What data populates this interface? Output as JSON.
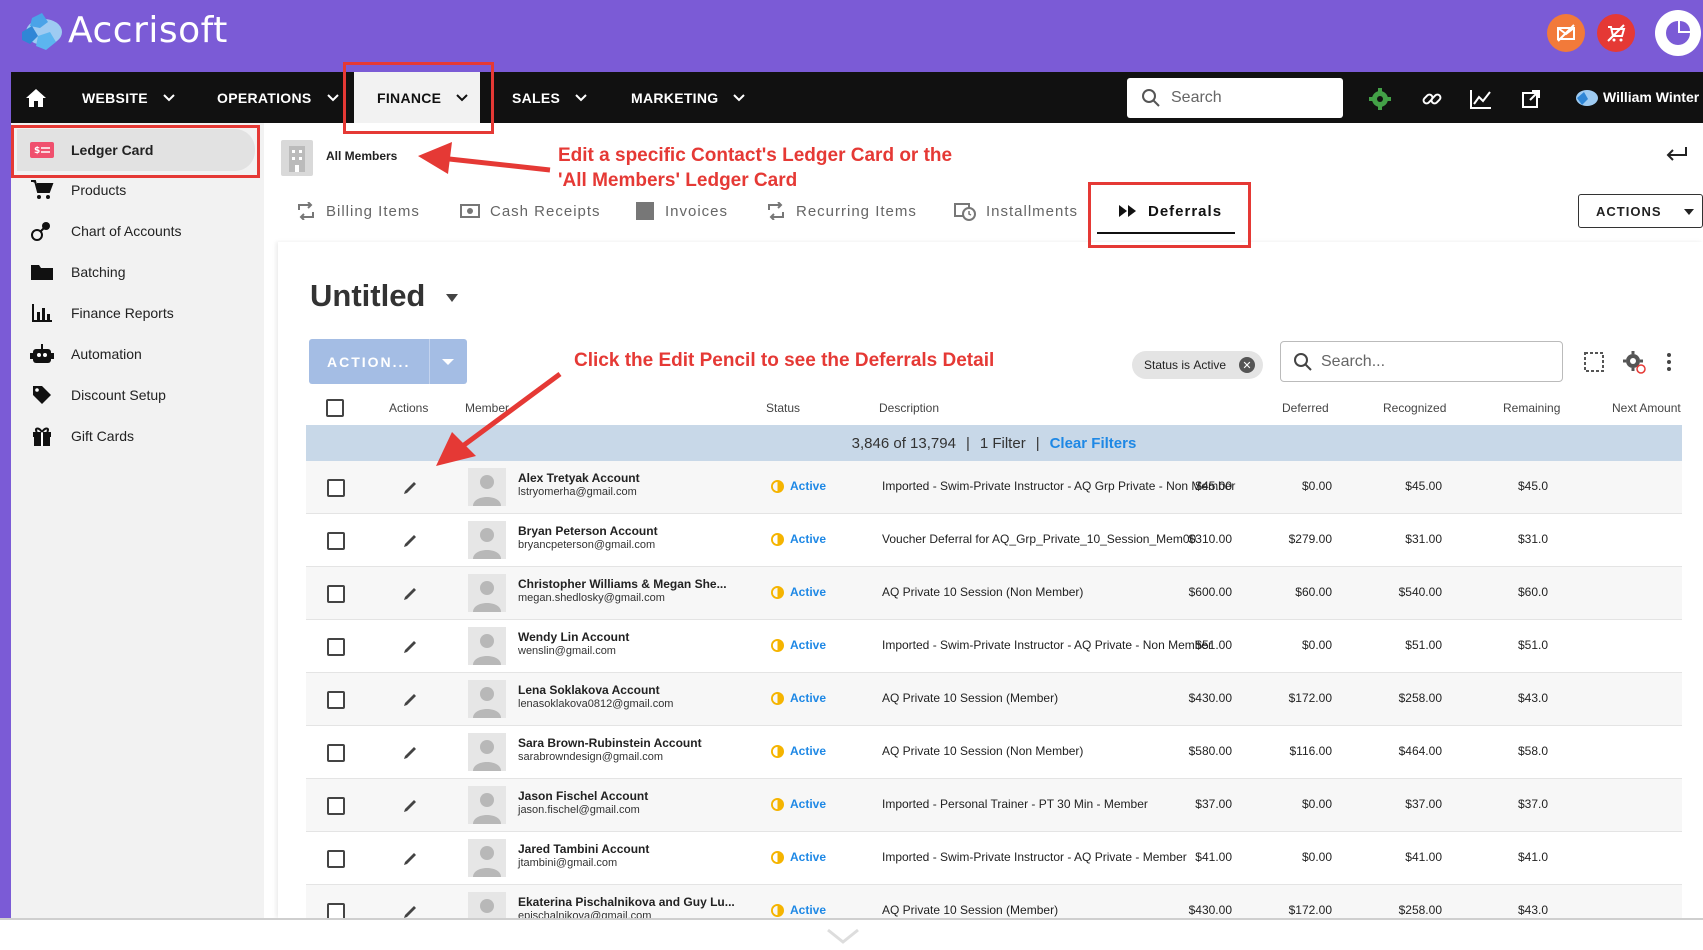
{
  "app": {
    "brand": "Accrisoft"
  },
  "nav": {
    "items": [
      {
        "label": "WEBSITE"
      },
      {
        "label": "OPERATIONS"
      },
      {
        "label": "FINANCE"
      },
      {
        "label": "SALES"
      },
      {
        "label": "MARKETING"
      }
    ],
    "search_placeholder": "Search",
    "user_name": "William Winter"
  },
  "sidebar": {
    "items": [
      {
        "label": "Ledger Card",
        "icon": "ledger-card-icon"
      },
      {
        "label": "Products",
        "icon": "cart-icon"
      },
      {
        "label": "Chart of Accounts",
        "icon": "accounts-icon"
      },
      {
        "label": "Batching",
        "icon": "folder-icon"
      },
      {
        "label": "Finance Reports",
        "icon": "bar-chart-icon"
      },
      {
        "label": "Automation",
        "icon": "robot-icon"
      },
      {
        "label": "Discount Setup",
        "icon": "tag-icon"
      },
      {
        "label": "Gift Cards",
        "icon": "gift-icon"
      }
    ]
  },
  "breadcrumb": {
    "label": "All Members"
  },
  "tabs": [
    {
      "label": "Billing Items"
    },
    {
      "label": "Cash Receipts"
    },
    {
      "label": "Invoices"
    },
    {
      "label": "Recurring Items"
    },
    {
      "label": "Installments"
    },
    {
      "label": "Deferrals"
    }
  ],
  "actions_button": "ACTIONS",
  "view": {
    "title": "Untitled",
    "action_button": "ACTION..."
  },
  "filter": {
    "chip_key": "Status",
    "chip_op": "is",
    "chip_value": "Active",
    "search_placeholder": "Search..."
  },
  "table": {
    "headers": [
      "Actions",
      "Member",
      "Status",
      "Description",
      "Deferred",
      "Recognized",
      "Remaining",
      "Next Amount"
    ],
    "summary": {
      "count": "3,846 of 13,794",
      "filters": "1 Filter",
      "clear": "Clear Filters"
    },
    "rows": [
      {
        "name": "Alex Tretyak Account",
        "email": "lstryomerha@gmail.com",
        "status": "Active",
        "description": "Imported - Swim-Private Instructor - AQ Grp Private - Non Member",
        "deferred": "$45.00",
        "recognized": "$0.00",
        "remaining": "$45.00",
        "next": "$45.0"
      },
      {
        "name": "Bryan Peterson Account",
        "email": "bryancpeterson@gmail.com",
        "status": "Active",
        "description": "Voucher Deferral for AQ_Grp_Private_10_Session_Mem00",
        "deferred": "$310.00",
        "recognized": "$279.00",
        "remaining": "$31.00",
        "next": "$31.0"
      },
      {
        "name": "Christopher Williams & Megan She...",
        "email": "megan.shedlosky@gmail.com",
        "status": "Active",
        "description": "AQ Private 10 Session (Non Member)",
        "deferred": "$600.00",
        "recognized": "$60.00",
        "remaining": "$540.00",
        "next": "$60.0"
      },
      {
        "name": "Wendy Lin Account",
        "email": "wenslin@gmail.com",
        "status": "Active",
        "description": "Imported - Swim-Private Instructor - AQ Private - Non Member",
        "deferred": "$51.00",
        "recognized": "$0.00",
        "remaining": "$51.00",
        "next": "$51.0"
      },
      {
        "name": "Lena Soklakova Account",
        "email": "lenasoklakova0812@gmail.com",
        "status": "Active",
        "description": "AQ Private 10 Session (Member)",
        "deferred": "$430.00",
        "recognized": "$172.00",
        "remaining": "$258.00",
        "next": "$43.0"
      },
      {
        "name": "Sara Brown-Rubinstein Account",
        "email": "sarabrowndesign@gmail.com",
        "status": "Active",
        "description": "AQ Private 10 Session (Non Member)",
        "deferred": "$580.00",
        "recognized": "$116.00",
        "remaining": "$464.00",
        "next": "$58.0"
      },
      {
        "name": "Jason Fischel Account",
        "email": "jason.fischel@gmail.com",
        "status": "Active",
        "description": "Imported - Personal Trainer - PT 30 Min - Member",
        "deferred": "$37.00",
        "recognized": "$0.00",
        "remaining": "$37.00",
        "next": "$37.0"
      },
      {
        "name": "Jared Tambini Account",
        "email": "jtambini@gmail.com",
        "status": "Active",
        "description": "Imported - Swim-Private Instructor - AQ Private - Member",
        "deferred": "$41.00",
        "recognized": "$0.00",
        "remaining": "$41.00",
        "next": "$41.0"
      },
      {
        "name": "Ekaterina Pischalnikova and Guy Lu...",
        "email": "epischalnikova@gmail.com",
        "status": "Active",
        "description": "AQ Private 10 Session (Member)",
        "deferred": "$430.00",
        "recognized": "$172.00",
        "remaining": "$258.00",
        "next": "$43.0"
      }
    ]
  },
  "annotations": {
    "ledger_note_line1": "Edit a specific Contact's Ledger Card or the",
    "ledger_note_line2": "'All Members' Ledger Card",
    "pencil_note": "Click the Edit Pencil to see the Deferrals Detail"
  },
  "colors": {
    "header": "#7b5bd6",
    "nav": "#111111",
    "accent": "#1e88e5",
    "annotation": "#e53935",
    "status": "#f5b400"
  }
}
